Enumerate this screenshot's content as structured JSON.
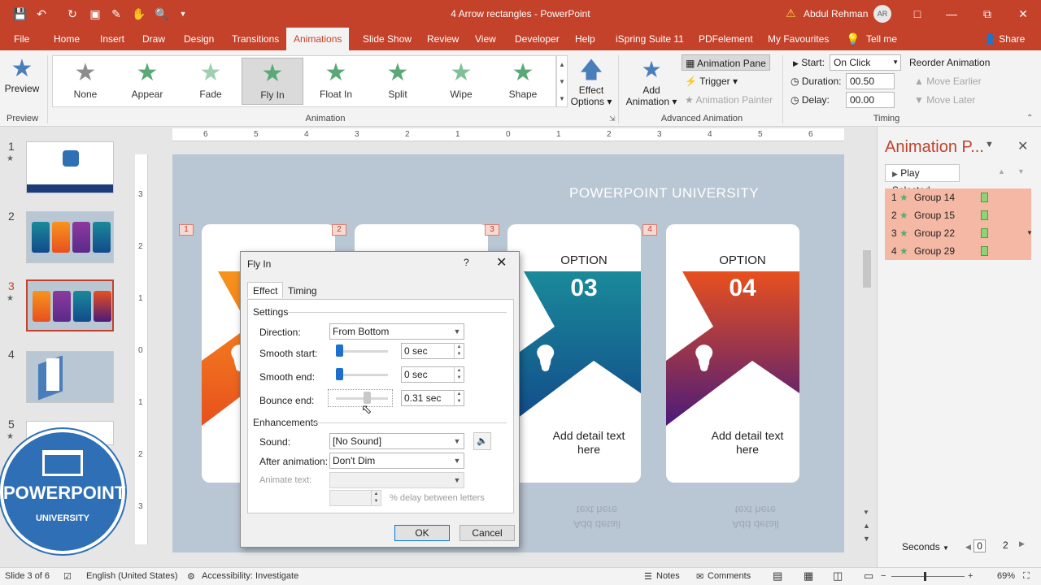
{
  "window": {
    "doc_title": "4 Arrow rectangles  -  PowerPoint",
    "user_name": "Abdul Rehman",
    "user_initials": "AR"
  },
  "tabs": [
    "File",
    "Home",
    "Insert",
    "Draw",
    "Design",
    "Transitions",
    "Animations",
    "Slide Show",
    "Review",
    "View",
    "Developer",
    "Help",
    "iSpring Suite 11",
    "PDFelement",
    "My Favourites",
    "Tell me"
  ],
  "active_tab": "Animations",
  "share_label": "Share",
  "ribbon": {
    "preview_label": "Preview",
    "preview_group": "Preview",
    "animation_group": "Animation",
    "advanced_group": "Advanced Animation",
    "timing_group": "Timing",
    "animations": [
      {
        "label": "None",
        "color": "#8c8c8c"
      },
      {
        "label": "Appear",
        "color": "#5aa876"
      },
      {
        "label": "Fade",
        "color": "#9ed0b0"
      },
      {
        "label": "Fly In",
        "color": "#5aa876"
      },
      {
        "label": "Float In",
        "color": "#5aa876"
      },
      {
        "label": "Split",
        "color": "#5aa876"
      },
      {
        "label": "Wipe",
        "color": "#7fc097"
      },
      {
        "label": "Shape",
        "color": "#5aa876"
      }
    ],
    "selected_animation": "Fly In",
    "effect_options_line1": "Effect",
    "effect_options_line2": "Options",
    "add_animation_line1": "Add",
    "add_animation_line2": "Animation",
    "animation_pane": "Animation Pane",
    "trigger": "Trigger",
    "animation_painter": "Animation Painter",
    "start_label": "Start:",
    "start_value": "On Click",
    "duration_label": "Duration:",
    "duration_value": "00.50",
    "delay_label": "Delay:",
    "delay_value": "00.00",
    "reorder": "Reorder Animation",
    "move_earlier": "Move Earlier",
    "move_later": "Move Later"
  },
  "thumbnails": [
    "1",
    "2",
    "3",
    "4",
    "5"
  ],
  "logo": {
    "text": "POWERPOINT",
    "sub": "UNIVERSITY"
  },
  "ruler": [
    "6",
    "5",
    "4",
    "3",
    "2",
    "1",
    "0",
    "1",
    "2",
    "3",
    "4",
    "5",
    "6"
  ],
  "vruler": [
    "3",
    "2",
    "1",
    "0",
    "1",
    "2",
    "3"
  ],
  "slide": {
    "title": "POWERPOINT UNIVERSITY",
    "cards": [
      {
        "num": "1",
        "option": "",
        "number": "",
        "detail": "",
        "color_a": "#f7941d",
        "color_b": "#e8501e"
      },
      {
        "num": "2",
        "option": "",
        "number": "",
        "detail": "",
        "color_a": "#8b3a9e",
        "color_b": "#5a2a8a"
      },
      {
        "num": "3",
        "option": "OPTION",
        "number": "03",
        "detail": "Add detail text here",
        "color_a": "#1a8a9a",
        "color_b": "#124a8a"
      },
      {
        "num": "4",
        "option": "OPTION",
        "number": "04",
        "detail": "Add detail text here",
        "color_a": "#e8501e",
        "color_b": "#4a1a7a"
      }
    ],
    "reflect_top": "text here",
    "reflect_bottom": "Add detail"
  },
  "dialog": {
    "title": "Fly In",
    "help": "?",
    "tab_effect": "Effect",
    "tab_timing": "Timing",
    "settings": "Settings",
    "direction_label": "Direction:",
    "direction_value": "From Bottom",
    "smooth_start_label": "Smooth start:",
    "smooth_start_value": "0 sec",
    "smooth_end_label": "Smooth end:",
    "smooth_end_value": "0 sec",
    "bounce_end_label": "Bounce end:",
    "bounce_end_value": "0.31 sec",
    "enhancements": "Enhancements",
    "sound_label": "Sound:",
    "sound_value": "[No Sound]",
    "after_label": "After animation:",
    "after_value": "Don't Dim",
    "animate_text_label": "Animate text:",
    "animate_text_value": "",
    "delay_letters": "% delay between letters",
    "ok": "OK",
    "cancel": "Cancel"
  },
  "pane": {
    "title": "Animation P...",
    "play": "Play Selected",
    "items": [
      {
        "num": "1",
        "name": "Group 14"
      },
      {
        "num": "2",
        "name": "Group 15"
      },
      {
        "num": "3",
        "name": "Group 22"
      },
      {
        "num": "4",
        "name": "Group 29"
      }
    ],
    "seconds": "Seconds",
    "scale_start": "0",
    "scale_end": "2"
  },
  "status": {
    "slide": "Slide 3 of 6",
    "language": "English (United States)",
    "accessibility": "Accessibility: Investigate",
    "notes": "Notes",
    "comments": "Comments",
    "zoom": "69%"
  }
}
